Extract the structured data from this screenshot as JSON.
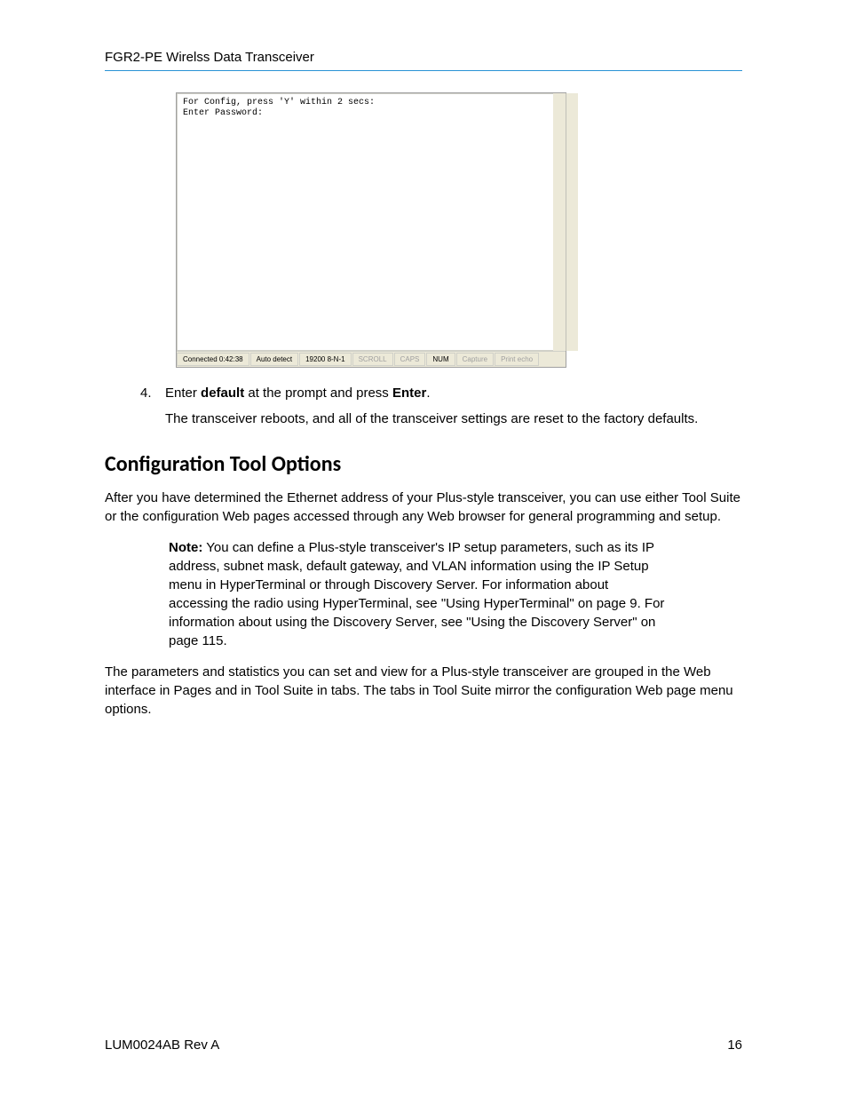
{
  "header": {
    "title": "FGR2-PE Wirelss Data Transceiver"
  },
  "terminal": {
    "line1": "For Config, press 'Y' within 2 secs:",
    "line2": "Enter Password:",
    "status": {
      "connected": "Connected 0:42:38",
      "autodetect": "Auto detect",
      "baud": "19200 8-N-1",
      "scroll": "SCROLL",
      "caps": "CAPS",
      "num": "NUM",
      "capture": "Capture",
      "printecho": "Print echo"
    }
  },
  "step": {
    "number": "4.",
    "text_before": "Enter ",
    "bold1": "default",
    "text_mid": " at the prompt and press ",
    "bold2": "Enter",
    "text_after": "."
  },
  "step_sub": "The transceiver reboots, and all of the transceiver settings are reset to the factory defaults.",
  "section_title": "Configuration Tool Options",
  "para1": "After you have determined the Ethernet address of your Plus-style transceiver, you can use either Tool Suite or the configuration Web pages accessed through any Web browser for general programming and setup.",
  "note": {
    "label": "Note:",
    "text": " You can define a Plus-style transceiver's IP setup parameters, such as its IP address, subnet mask, default gateway, and VLAN information using the IP Setup menu in HyperTerminal or through Discovery Server. For information about accessing the radio using HyperTerminal, see \"Using HyperTerminal\" on page 9. For information about using the Discovery Server, see \"Using the Discovery Server\" on page 115."
  },
  "para2": "The parameters and statistics you can set and view for a Plus-style transceiver are grouped in the Web interface in Pages and in Tool Suite in tabs. The tabs in Tool Suite mirror the configuration Web page menu options.",
  "footer": {
    "doc_id": "LUM0024AB Rev A",
    "page_num": "16"
  }
}
